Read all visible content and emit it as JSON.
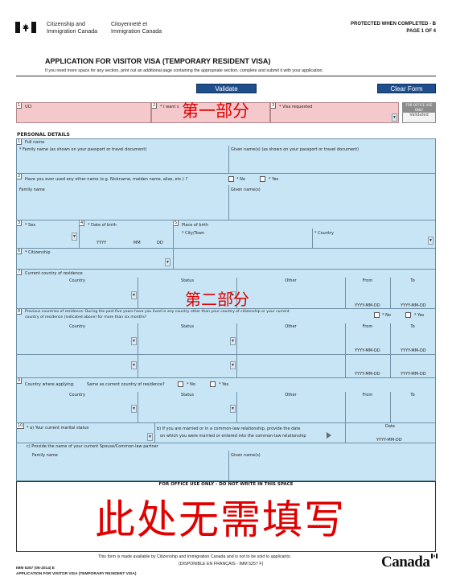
{
  "header": {
    "dept_en_1": "Citizenship and",
    "dept_en_2": "Immigration Canada",
    "dept_fr_1": "Citoyenneté et",
    "dept_fr_2": "Immigration Canada",
    "protected": "PROTECTED WHEN COMPLETED - B",
    "page": "PAGE 1 OF 4"
  },
  "form": {
    "title": "APPLICATION FOR VISITOR VISA (TEMPORARY RESIDENT VISA)",
    "instructions": "If you need more space for any section, print out an additional page containing the appropriate section, complete and submit it with your application.",
    "validate_label": "Validate",
    "clear_label": "Clear Form"
  },
  "top_fields": {
    "uci_num": "1",
    "uci_label": "UCI",
    "want_num": "2",
    "want_label": "* I want s",
    "visa_num": "3",
    "visa_label": "* Visa requested",
    "office_use_1": "FOR OFFICE USE ONLY",
    "office_use_2": "Validated",
    "overlay_note": "第一部分"
  },
  "personal": {
    "section_title": "PERSONAL DETAILS",
    "full_name_num": "1",
    "full_name_label": "Full name",
    "family_name_label": "* Family name (as shown on your passport or travel document)",
    "given_names_label": "Given name(s) (as shown on your passport or travel document)",
    "other_name_num": "2",
    "other_name_label": "Have you ever used any other name (e.g. Nickname, maiden name, alias, etc.) ?",
    "no_label": "* No",
    "yes_label": "* Yes",
    "family_name_short": "Family name",
    "given_names_short": "Given name(s)",
    "sex_num": "3",
    "sex_label": "* Sex",
    "dob_num": "4",
    "dob_label": "* Date of birth",
    "dob_yy": "YYYY",
    "dob_mm": "MM",
    "dob_dd": "DD",
    "pob_num": "5",
    "pob_label": "Place of birth",
    "city_label": "* City/Town",
    "country_label": "* Country",
    "citizenship_num": "6",
    "citizenship_label": "* Citizenship",
    "cur_res_num": "7",
    "cur_res_label": "Current country of residence",
    "col_country": "Country",
    "col_status": "Status",
    "col_other": "Other",
    "col_from": "From",
    "col_to": "To",
    "date_fmt": "YYYY-MM-DD",
    "overlay_note2": "第二部分",
    "prev_res_num": "8",
    "prev_res_label_1": "Previous countries of residence: During the past five years have you lived in any country other than your country of citizenship or your current",
    "prev_res_label_2": "country of residence (indicated above) for more than six months?",
    "apply_num": "9",
    "apply_label": "Country where applying:",
    "apply_same": "Same as current country of residence?",
    "marital_num": "10",
    "marital_a": "* a) Your current marital status",
    "marital_b_1": "b) If you are married or in a common-law relationship, provide the date",
    "marital_b_2": "on which you were married or entered into the common-law relationship",
    "date_label": "Date",
    "marital_c": "c) Provide the name of your current Spouse/Common-law partner",
    "spouse_family": "Family name",
    "spouse_given": "Given name(s)"
  },
  "office": {
    "label": "FOR OFFICE USE ONLY - DO NOT WRITE IN THIS SPACE",
    "overlay_note3": "此处无需填写"
  },
  "footer": {
    "availability": "This form is made available by Citizenship and Immigration Canada and is not to be sold to applicants.",
    "french": "(DISPONIBLE EN FRANÇAIS - IMM 5257 F)",
    "form_num": "IMM 5257 (06-2014) E",
    "form_title": "APPLICATION FOR VISITOR VISA (TEMPORARY RESIDENT VISA)",
    "wordmark": "Canada"
  }
}
